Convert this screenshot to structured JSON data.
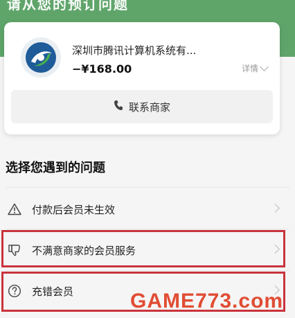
{
  "header": {
    "title": "请从您的预订问题"
  },
  "merchant": {
    "name": "深圳市腾讯计算机系统有...",
    "amount": "−¥168.00",
    "detail_label": "详情",
    "contact_label": "联系商家"
  },
  "problems": {
    "title": "选择您遇到的问题",
    "items": [
      {
        "label": "付款后会员未生效",
        "icon": "warning-icon"
      },
      {
        "label": "不满意商家的会员服务",
        "icon": "thumbs-down-icon"
      },
      {
        "label": "充错会员",
        "icon": "question-icon"
      }
    ]
  },
  "watermark": "GAME773.com",
  "colors": {
    "header_green": "#5fa56a",
    "highlight_red": "#c9343c"
  }
}
